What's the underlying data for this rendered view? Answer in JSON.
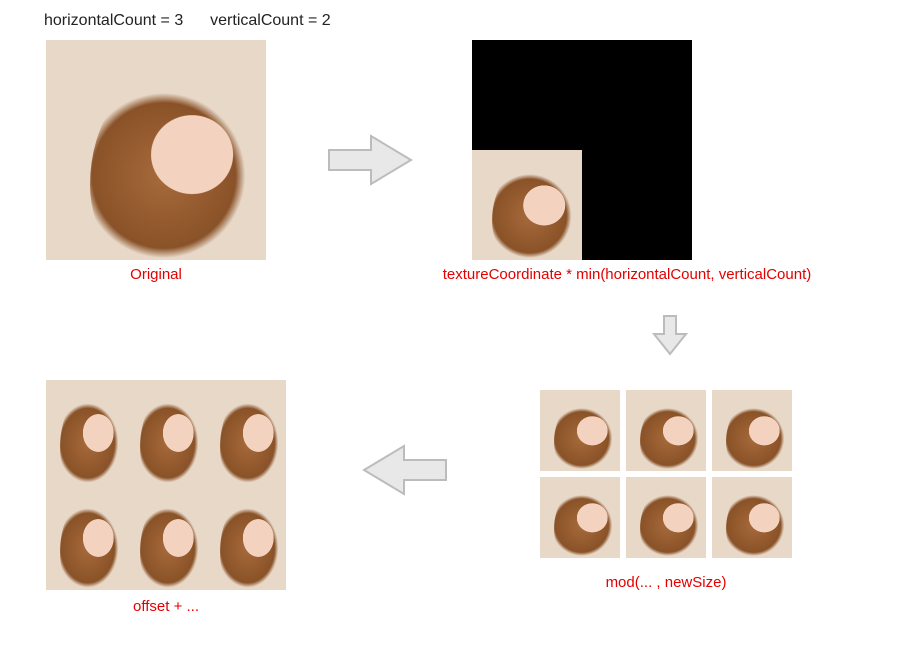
{
  "header": {
    "param1_label": "horizontalCount",
    "param1_value": "3",
    "param2_label": "verticalCount",
    "param2_value": "2"
  },
  "captions": {
    "original": "Original",
    "scaled": "textureCoordinate * min(horizontalCount, verticalCount)",
    "tiled": "mod(... , newSize)",
    "offset": "offset + ..."
  },
  "colors": {
    "caption": "#e40000",
    "arrow_fill": "#e8e8e8",
    "arrow_stroke": "#bcbcbc"
  },
  "grid": {
    "horizontalCount": 3,
    "verticalCount": 2
  }
}
